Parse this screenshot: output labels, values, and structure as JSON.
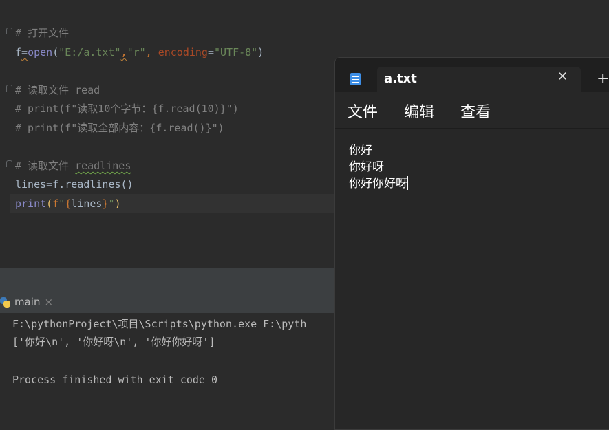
{
  "editor": {
    "lines": {
      "c1": "# 打开文件",
      "l2a": "f",
      "l2b": "=",
      "l2c": "open",
      "l2d": "(",
      "l2e": "\"E:/a.txt\"",
      "l2f": ",",
      "l2g": "\"r\"",
      "l2h": ", ",
      "l2i": "encoding",
      "l2j": "=",
      "l2k": "\"UTF-8\"",
      "l2l": ")",
      "c4": "# 读取文件 read",
      "c5": "# print(f\"读取10个字节：{f.read(10)}\")",
      "c6": "# print(f\"读取全部内容：{f.read()}\")",
      "c8a": "# 读取文件 ",
      "c8b": "readlines",
      "l9": "lines=f.readlines()",
      "l10a": "print",
      "l10b": "(",
      "l10c": "f",
      "l10d": "\"",
      "l10e": "{",
      "l10f": "lines",
      "l10g": "}",
      "l10h": "\"",
      "l10i": ")"
    }
  },
  "run_panel": {
    "tab_label": "main",
    "close_glyph": "×",
    "console_lines": [
      "F:\\pythonProject\\项目\\Scripts\\python.exe F:\\pyth",
      "['你好\\n', '你好呀\\n', '你好你好呀']",
      "",
      "Process finished with exit code 0"
    ]
  },
  "notepad": {
    "tab_title": "a.txt",
    "close_glyph": "✕",
    "new_tab_glyph": "+",
    "menu": [
      "文件",
      "编辑",
      "查看"
    ],
    "content_lines": [
      "你好",
      "你好呀",
      "你好你好呀"
    ],
    "icon": "notepad-icon"
  },
  "colors": {
    "editor_bg": "#2b2b2b",
    "comment": "#808080",
    "string": "#6a8759",
    "keyword": "#cc7832",
    "notepad_bg": "#272727"
  }
}
